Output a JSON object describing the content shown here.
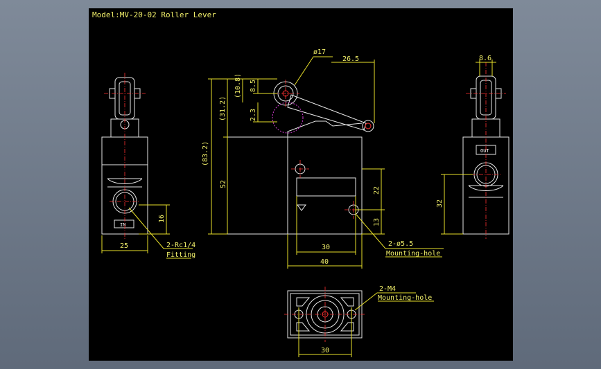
{
  "title": "Model:MV-20-02 Roller Lever",
  "dims": {
    "d17": "ø17",
    "d26_5": "26.5",
    "d8_6": "8.6",
    "d10_8": "(10.8)",
    "d8_5": "8.5",
    "d31_2": "(31.2)",
    "d2_3": "2.3",
    "d83_2": "(83.2)",
    "d52": "52",
    "d22": "22",
    "d13": "13",
    "d16": "16",
    "d25": "25",
    "d30a": "30",
    "d40": "40",
    "d32": "32",
    "d30b": "30"
  },
  "labels": {
    "rc_line1": "2-Rc1/4",
    "rc_line2": "Fitting",
    "hole_line1": "2-ø5.5",
    "hole_line2": "Mounting-hole",
    "m4_line1": "2-M4",
    "m4_line2": "Mounting-hole",
    "in_port": "IN",
    "out_port": "OUT"
  },
  "colors": {
    "background": "#000000",
    "outline": "#e6e6e6",
    "dimension": "#e8e02a",
    "centerline": "#ff3030",
    "hidden": "#d23cd2"
  }
}
